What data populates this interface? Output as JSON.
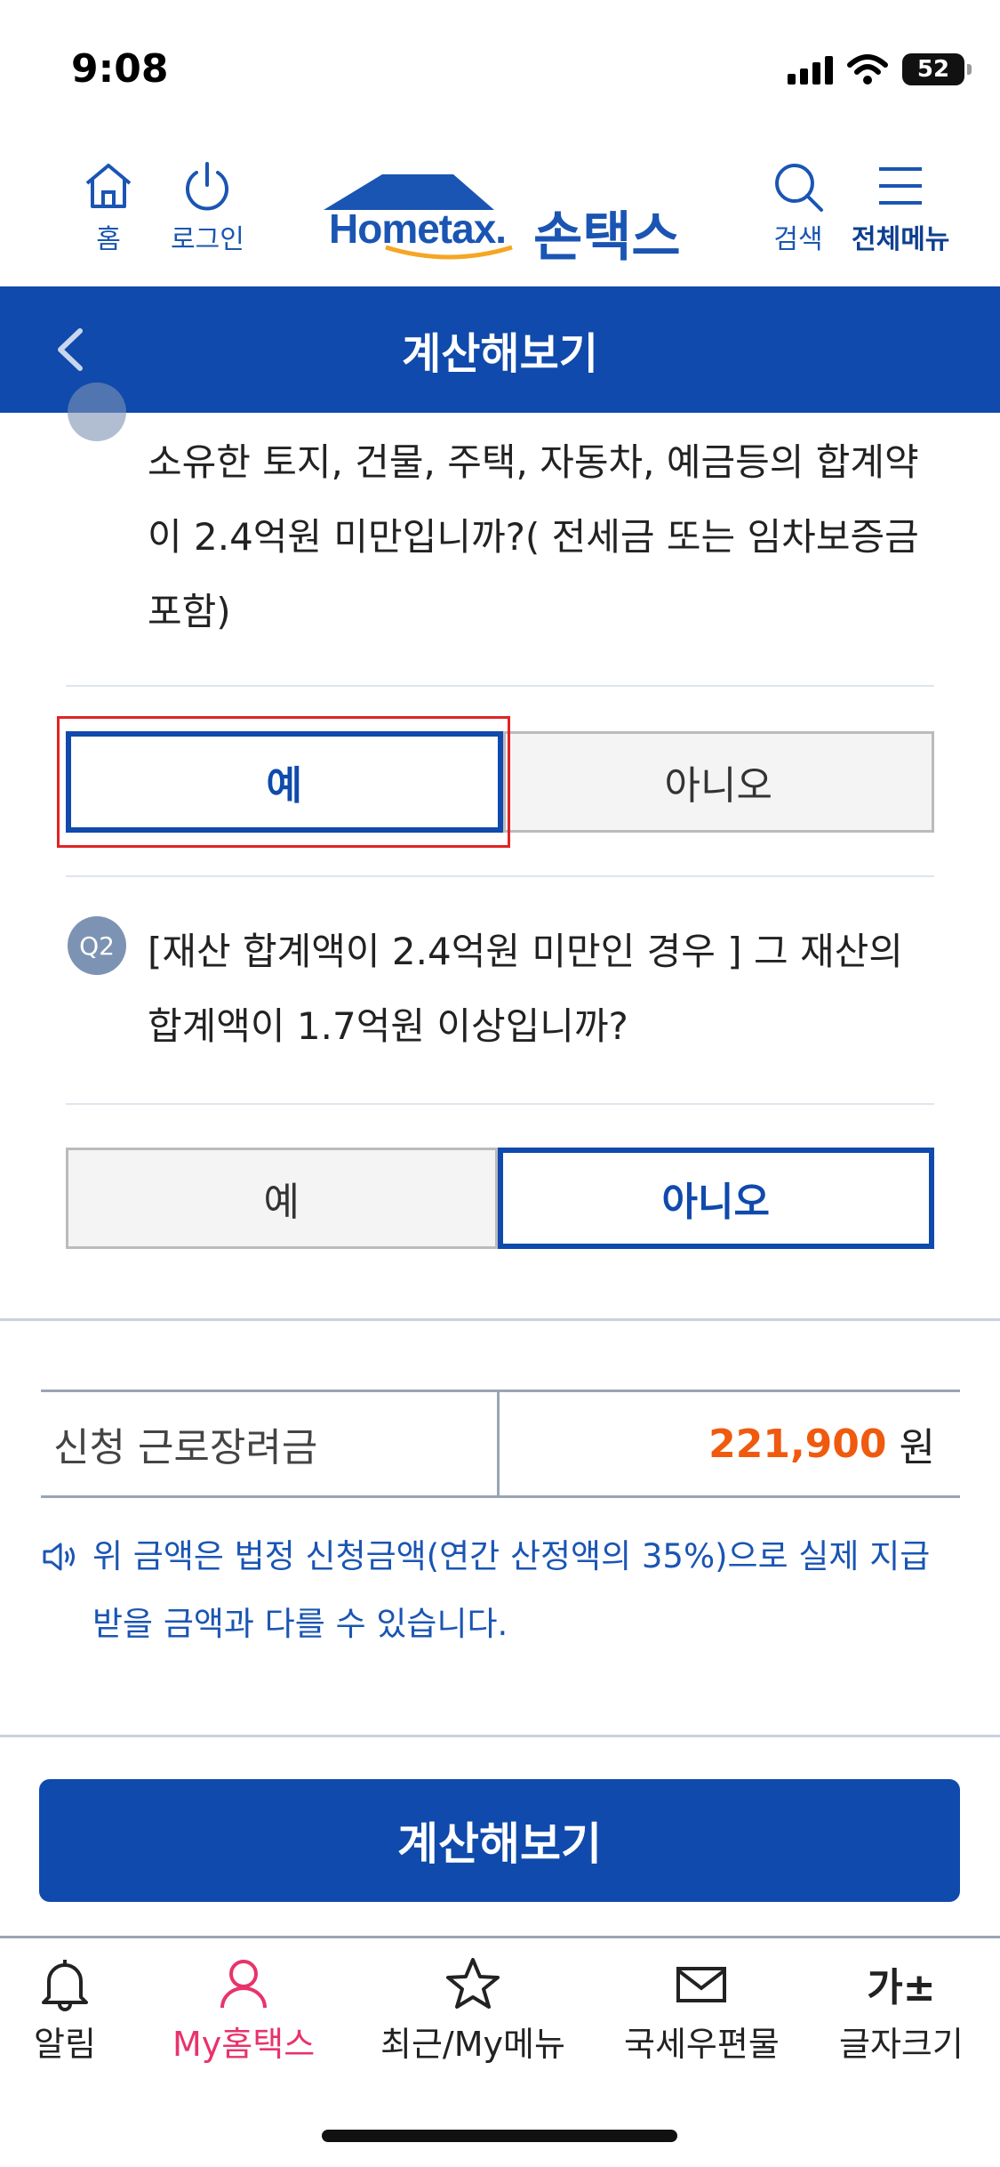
{
  "status_bar": {
    "time": "9:08",
    "battery": "52"
  },
  "header": {
    "home_label": "홈",
    "login_label": "로그인",
    "logo_text": "Hometax.",
    "logo_korean": "손택스",
    "search_label": "검색",
    "menu_label": "전체메뉴"
  },
  "title_bar": {
    "title": "계산해보기"
  },
  "question1": {
    "text": "소유한 토지, 건물, 주택, 자동차, 예금등의 합계약이 2.4억원 미만입니까?( 전세금 또는 임차보증금 포함)",
    "yes_label": "예",
    "no_label": "아니오",
    "selected": "yes"
  },
  "question2": {
    "badge": "Q2",
    "text": "[재산 합계액이 2.4억원 미만인 경우 ] 그 재산의 합계액이 1.7억원 이상입니까?",
    "yes_label": "예",
    "no_label": "아니오",
    "selected": "no"
  },
  "result": {
    "label": "신청 근로장려금",
    "amount": "221,900",
    "unit": "원",
    "notice": "위 금액은 법정 신청금액(연간 산정액의 35%)으로 실제 지급받을 금액과 다를 수 있습니다."
  },
  "calc_button": "계산해보기",
  "tabs": [
    {
      "label": "알림",
      "icon": "bell-icon"
    },
    {
      "label": "My홈택스",
      "icon": "person-icon"
    },
    {
      "label": "최근/My메뉴",
      "icon": "star-icon"
    },
    {
      "label": "국세우편물",
      "icon": "mail-icon"
    },
    {
      "label": "글자크기",
      "icon": "font-size-icon",
      "glyph": "가±"
    }
  ],
  "colors": {
    "primary": "#0f4aac",
    "accent": "#ef5a0f",
    "active_tab": "#e8336b",
    "highlight": "#e02424"
  }
}
